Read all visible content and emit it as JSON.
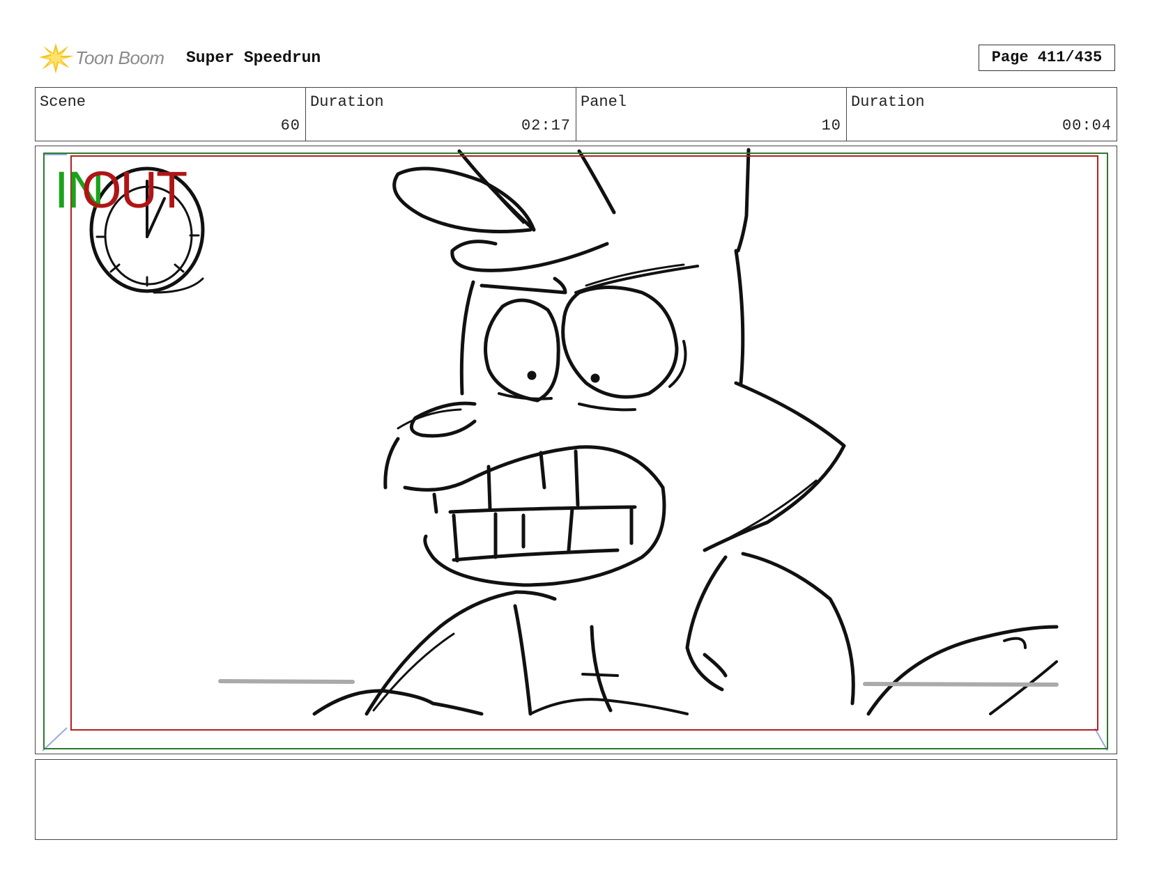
{
  "header": {
    "logo_text": "Toon Boom",
    "project_title": "Super Speedrun",
    "page_label": "Page 411/435"
  },
  "info": {
    "scene_label": "Scene",
    "scene_value": "60",
    "scene_duration_label": "Duration",
    "scene_duration_value": "02:17",
    "panel_label": "Panel",
    "panel_value": "10",
    "panel_duration_label": "Duration",
    "panel_duration_value": "00:04"
  },
  "panel": {
    "in_marker": "IN",
    "out_marker": "OUT",
    "icons": [
      "stopwatch-icon"
    ],
    "colors": {
      "safe_area": "#2b7a2b",
      "action_area": "#b02020",
      "in": "#1aa31a",
      "out": "#b01515"
    }
  },
  "notes": {
    "text": ""
  }
}
